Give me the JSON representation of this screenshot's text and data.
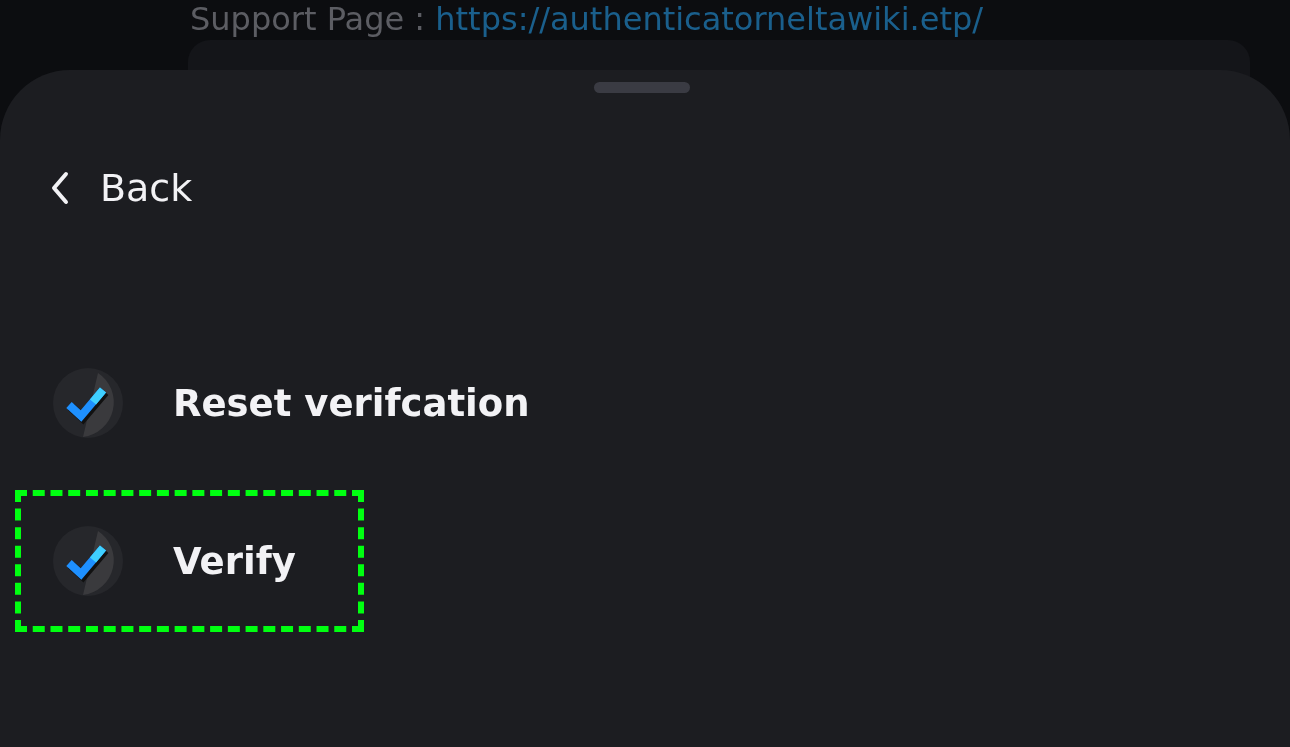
{
  "background": {
    "label": "Support Page : ",
    "link": "https://authenticatorneltawiki.etp/"
  },
  "sheet": {
    "back": "Back",
    "items": [
      {
        "label": "Reset verifcation",
        "highlighted": false
      },
      {
        "label": "Verify",
        "highlighted": true
      }
    ]
  }
}
